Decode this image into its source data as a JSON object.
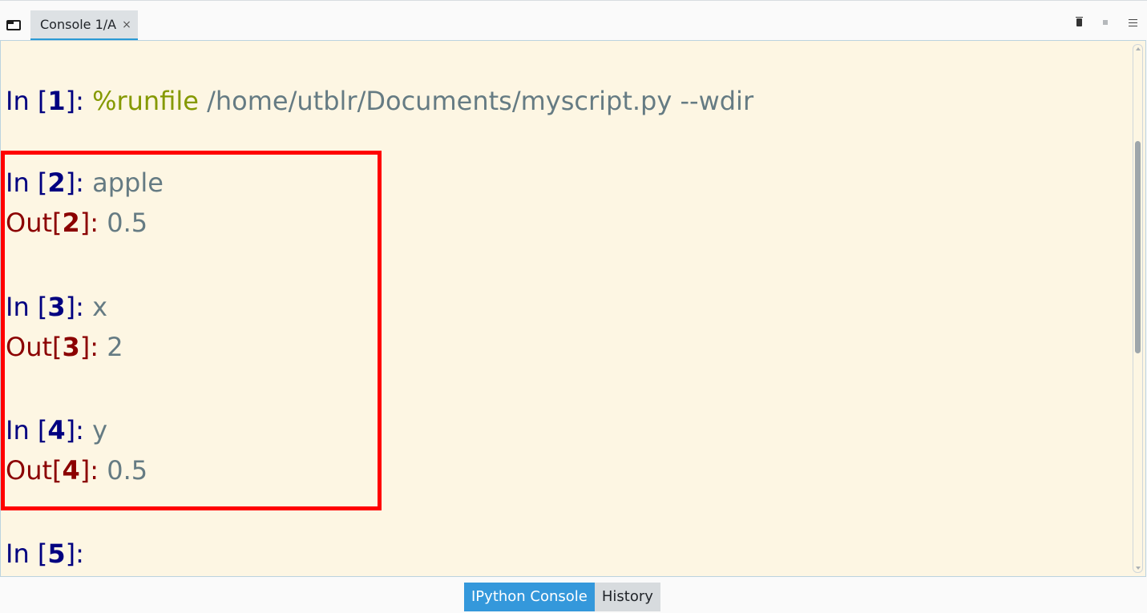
{
  "tabbar": {
    "tab_label": "Console 1/A",
    "close_glyph": "×"
  },
  "toolbar": {
    "icons": [
      "trash-icon",
      "stop-icon",
      "menu-icon"
    ]
  },
  "console": {
    "colors": {
      "background": "#fdf6e3",
      "in_prompt": "#000080",
      "out_prompt": "#8b0000",
      "code": "#657b83",
      "magic": "#859900",
      "highlight_border": "#ff0000"
    },
    "cells": [
      {
        "in_label": "In [",
        "number": "1",
        "close": "]: ",
        "magic": "%runfile",
        "code": " /home/utblr/Documents/myscript.py --wdir"
      },
      {
        "in_label": "In [",
        "number": "2",
        "close": "]: ",
        "code": "apple",
        "out_label": "Out[",
        "out_number": "2",
        "out_close": "]: ",
        "out_value": "0.5"
      },
      {
        "in_label": "In [",
        "number": "3",
        "close": "]: ",
        "code": "x",
        "out_label": "Out[",
        "out_number": "3",
        "out_close": "]: ",
        "out_value": "2"
      },
      {
        "in_label": "In [",
        "number": "4",
        "close": "]: ",
        "code": "y",
        "out_label": "Out[",
        "out_number": "4",
        "out_close": "]: ",
        "out_value": "0.5"
      },
      {
        "in_label": "In [",
        "number": "5",
        "close": "]: ",
        "code": ""
      }
    ]
  },
  "bottom_tabs": [
    {
      "label": "IPython Console",
      "active": true
    },
    {
      "label": "History",
      "active": false
    }
  ]
}
